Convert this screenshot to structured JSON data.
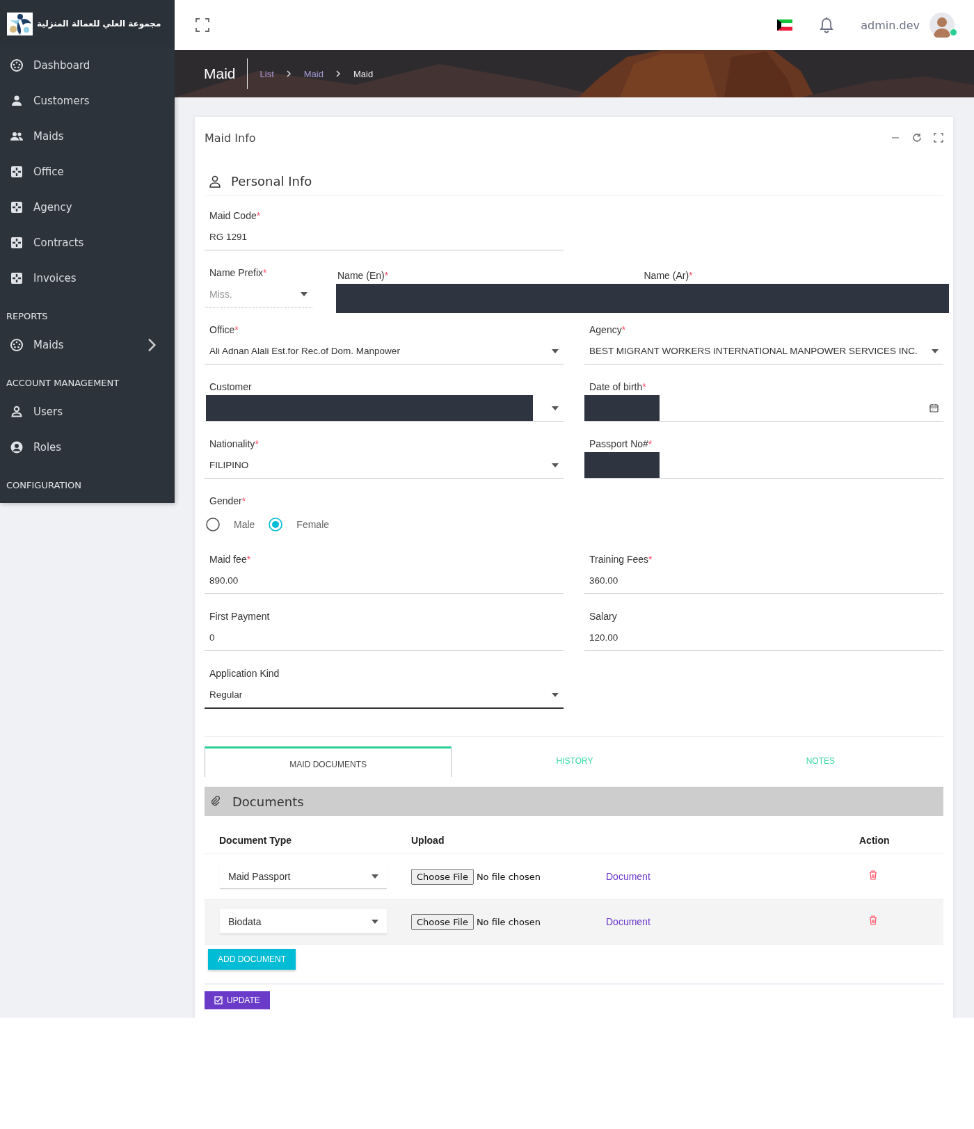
{
  "brand": {
    "name": "مجموعة العلي للعمالة المنزلية"
  },
  "sidebar": {
    "sections": [
      {
        "items": [
          {
            "label": "Dashboard",
            "kind": "gauge"
          },
          {
            "label": "Customers",
            "kind": "user"
          },
          {
            "label": "Maids",
            "kind": "users"
          },
          {
            "label": "Office",
            "kind": "module"
          },
          {
            "label": "Agency",
            "kind": "module"
          },
          {
            "label": "Contracts",
            "kind": "module"
          },
          {
            "label": "Invoices",
            "kind": "module"
          }
        ]
      },
      {
        "heading": "REPORTS",
        "items": [
          {
            "label": "Maids",
            "kind": "gauge",
            "expandable": true
          }
        ]
      },
      {
        "heading": "ACCOUNT MANAGEMENT",
        "items": [
          {
            "label": "Users",
            "kind": "user-outline"
          },
          {
            "label": "Roles",
            "kind": "user-circle"
          }
        ]
      },
      {
        "heading": "CONFIGURATION"
      }
    ]
  },
  "topbar": {
    "username": "admin.dev",
    "online": true
  },
  "page_header": {
    "title": "Maid",
    "breadcrumb": [
      {
        "label": "List",
        "current": false
      },
      {
        "label": "Maid",
        "current": false
      },
      {
        "label": "Maid",
        "current": true
      }
    ]
  },
  "card": {
    "title": "Maid Info",
    "section_title": "Personal Info",
    "maid_code": {
      "label": "Maid Code",
      "mark": "*",
      "value": "RG 1291"
    },
    "name_prefix": {
      "label": "Name Prefix",
      "mark": "*",
      "placeholder": "Miss."
    },
    "name_en": {
      "label": "Name (En)",
      "mark": "*"
    },
    "name_ar": {
      "label": "Name (Ar)",
      "mark": "*"
    },
    "rows": [
      [
        {
          "kind": "select",
          "label": "Office",
          "mark": "*",
          "value": "Ali Adnan Alali Est.for Rec.of Dom. Manpower"
        },
        {
          "kind": "select",
          "label": "Agency",
          "mark": "*",
          "value": "BEST MIGRANT WORKERS INTERNATIONAL MANPOWER SERVICES INC."
        }
      ],
      [
        {
          "kind": "select",
          "label": "Customer",
          "redacted": true
        },
        {
          "kind": "date",
          "label": "Date of birth",
          "mark": "*",
          "redacted": true
        }
      ],
      [
        {
          "kind": "select",
          "label": "Nationality",
          "mark": "*",
          "value": "FILIPINO"
        },
        {
          "kind": "text",
          "label": "Passport No#",
          "mark": "*",
          "redacted": true
        }
      ],
      [
        {
          "kind": "radio",
          "label": "Gender",
          "mark": "*",
          "options": [
            {
              "label": "Male",
              "selected": false
            },
            {
              "label": "Female",
              "selected": true
            }
          ]
        }
      ],
      [
        {
          "kind": "text",
          "label": "Maid fee",
          "mark": "*",
          "value": "890.00"
        },
        {
          "kind": "text",
          "label": "Training Fees",
          "mark": "*",
          "value": "360.00"
        }
      ],
      [
        {
          "kind": "text",
          "label": "First Payment",
          "value": "0"
        },
        {
          "kind": "text",
          "label": "Salary",
          "value": "120.00"
        }
      ],
      [
        {
          "kind": "select",
          "label": "Application Kind",
          "value": "Regular",
          "focused": true
        }
      ]
    ],
    "tabs": [
      {
        "label": "MAID DOCUMENTS",
        "selected": true
      },
      {
        "label": "HISTORY",
        "selected": false
      },
      {
        "label": "NOTES",
        "selected": false
      }
    ],
    "documents": {
      "title": "Documents",
      "columns": [
        "Document Type",
        "Upload",
        "Action"
      ],
      "rows": [
        {
          "type": "Maid Passport",
          "file_button": "Choose File",
          "file_status": "No file chosen",
          "link": "Document"
        },
        {
          "type": "Biodata",
          "file_button": "Choose File",
          "file_status": "No file chosen",
          "link": "Document"
        }
      ],
      "add_button": "ADD DOCUMENT"
    },
    "update_button": "UPDATE"
  }
}
